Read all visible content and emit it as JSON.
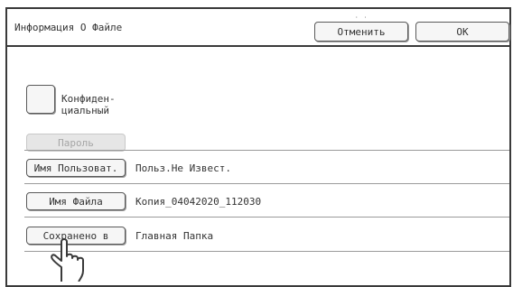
{
  "title": "Информация О Файле",
  "buttons": {
    "cancel": "Отменить",
    "ok": "OK",
    "password": "Пароль"
  },
  "confidential": {
    "label": "Конфиден-\nциальный",
    "checked": false
  },
  "rows": [
    {
      "button": "Имя Пользоват.",
      "value": "Польз.Не Извест."
    },
    {
      "button": "Имя Файла",
      "value": "Копия_04042020_112030"
    },
    {
      "button": "Сохранено в",
      "value": "Главная Папка"
    }
  ],
  "icons": {
    "pointer": "pointing-hand-icon"
  },
  "colors": {
    "border": "#3a3a3a",
    "text": "#333333",
    "disabled": "#a6a6a6"
  }
}
